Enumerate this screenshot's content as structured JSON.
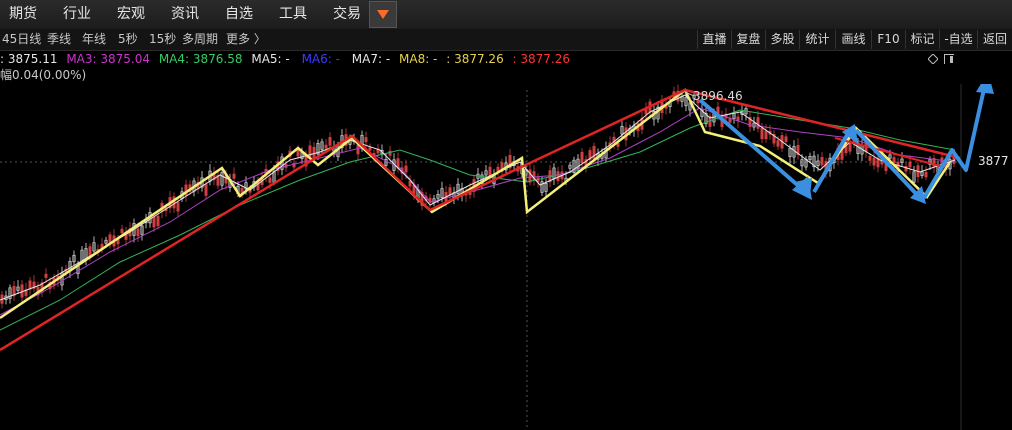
{
  "menu": [
    {
      "label": "期货"
    },
    {
      "label": "行业"
    },
    {
      "label": "宏观"
    },
    {
      "label": "资讯"
    },
    {
      "label": "自选"
    },
    {
      "label": "工具"
    },
    {
      "label": "交易"
    }
  ],
  "periods": [
    {
      "label": "45日线"
    },
    {
      "label": "季线"
    },
    {
      "label": "年线"
    },
    {
      "label": "5秒"
    },
    {
      "label": "15秒"
    },
    {
      "label": "多周期"
    },
    {
      "label": "更多 〉"
    }
  ],
  "tools": [
    {
      "label": "直播"
    },
    {
      "label": "复盘"
    },
    {
      "label": "多股"
    },
    {
      "label": "统计"
    },
    {
      "label": "画线"
    },
    {
      "label": "F10"
    },
    {
      "label": "标记"
    },
    {
      "label": "-自选"
    },
    {
      "label": "返回"
    }
  ],
  "ma": {
    "ma2": ": 3875.11",
    "ma3": "MA3: 3875.04",
    "ma4": "MA4: 3876.58",
    "ma5": "MA5: -",
    "ma6": "MA6: -",
    "ma7": "MA7: -",
    "ma8": "MA8: -",
    "v1": ": 3877.26",
    "v2": ": 3877.26"
  },
  "amplitude": "幅0.04(0.00%)",
  "chart": {
    "high_label": "3896.46",
    "price_label": "3877"
  },
  "colors": {
    "ma2": "#e6e6e6",
    "ma3": "#cc33cc",
    "ma4": "#33cc66",
    "ma5": "#e6e6e6",
    "ma6": "#3333ff",
    "ma7": "#e6e6e6",
    "ma8": "#e6d24a",
    "v2": "#ff3333",
    "trend_red": "#e02424",
    "trend_yellow": "#f3ef7a",
    "arrow_blue": "#3a8fe0"
  }
}
